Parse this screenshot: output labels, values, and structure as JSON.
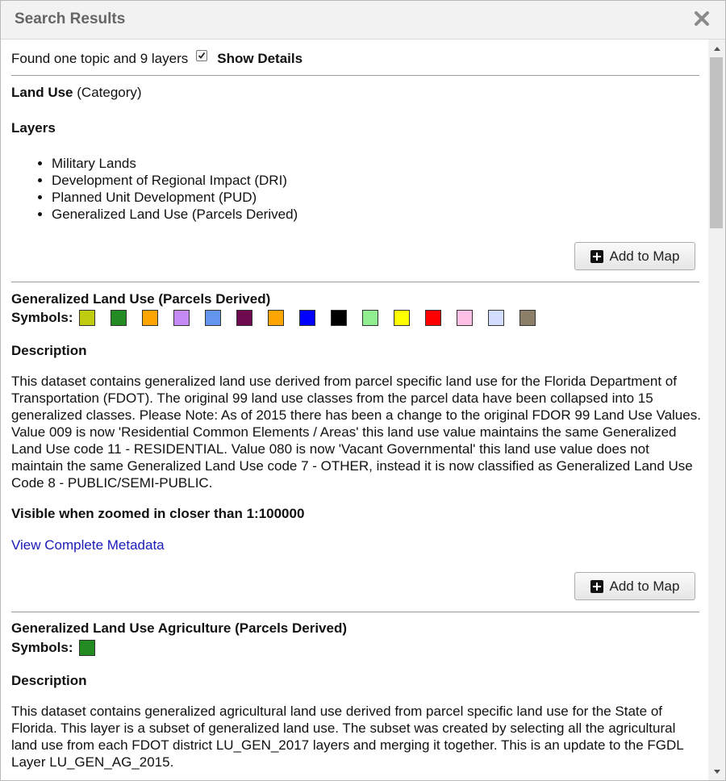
{
  "dialog": {
    "title": "Search Results"
  },
  "summary": {
    "found_text": "Found one topic and 9 layers",
    "show_details_label": "Show Details",
    "show_details_checked": true
  },
  "topic": {
    "name": "Land Use",
    "type_label": "(Category)",
    "layers_heading": "Layers",
    "layers": [
      "Military Lands",
      "Development of Regional Impact (DRI)",
      "Planned Unit Development (PUD)",
      "Generalized Land Use (Parcels Derived)"
    ],
    "add_button": "Add to Map"
  },
  "results": [
    {
      "title": "Generalized Land Use (Parcels Derived)",
      "symbols_label": "Symbols:",
      "symbol_colors": [
        "#bfcc0f",
        "#228b22",
        "#ffa500",
        "#c58af4",
        "#6495ed",
        "#6e0a4f",
        "#ffa500",
        "#0000ff",
        "#000000",
        "#90ee90",
        "#ffff00",
        "#ff0000",
        "#ffc0e6",
        "#d3ddff",
        "#8b7f6a"
      ],
      "description_heading": "Description",
      "description": "This dataset contains generalized land use derived from parcel specific land use for the Florida Department of Transportation (FDOT). The original 99 land use classes from the parcel data have been collapsed into 15 generalized classes. Please Note: As of 2015 there has been a change to the original FDOR 99 Land Use Values. Value 009 is now 'Residential Common Elements / Areas' this land use value maintains the same Generalized Land Use code 11 - RESIDENTIAL. Value 080 is now 'Vacant Governmental' this land use value does not maintain the same Generalized Land Use code 7 - OTHER, instead it is now classified as Generalized Land Use Code 8 - PUBLIC/SEMI-PUBLIC.",
      "visibility": "Visible when zoomed in closer than 1:100000",
      "metadata_link": "View Complete Metadata",
      "add_button": "Add to Map"
    },
    {
      "title": "Generalized Land Use Agriculture (Parcels Derived)",
      "symbols_label": "Symbols:",
      "symbol_colors": [
        "#228b22"
      ],
      "description_heading": "Description",
      "description": "This dataset contains generalized agricultural land use derived from parcel specific land use for the State of Florida. This layer is a subset of generalized land use. The subset was created by selecting all the agricultural land use from each FDOT district LU_GEN_2017 layers and merging it together. This is an update to the FGDL Layer LU_GEN_AG_2015."
    }
  ]
}
